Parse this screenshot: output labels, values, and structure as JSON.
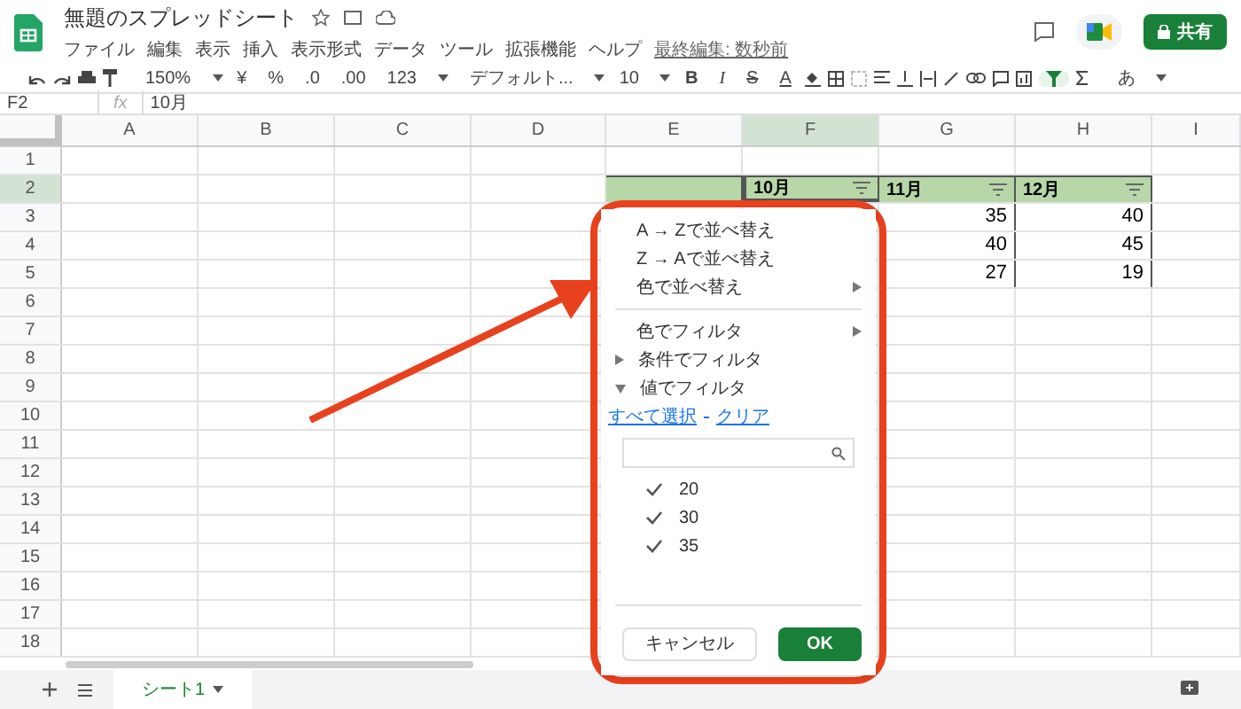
{
  "document": {
    "title": "無題のスプレッドシート",
    "last_edit": "最終編集: 数秒前",
    "share": "共有"
  },
  "menu": [
    "ファイル",
    "編集",
    "表示",
    "挿入",
    "表示形式",
    "データ",
    "ツール",
    "拡張機能",
    "ヘルプ"
  ],
  "toolbar": {
    "zoom": "150%",
    "currency": "¥",
    "percent": "%",
    "decrease_decimal": ".0",
    "increase_decimal": ".00",
    "number_format": "123",
    "font": "デフォルト...",
    "font_size": "10",
    "bold": "B",
    "italic": "I",
    "strike": "S",
    "text_color": "A",
    "input_tool": "あ",
    "filter_on": true
  },
  "formula_bar": {
    "cell": "F2",
    "fx": "fx",
    "value": "10月"
  },
  "columns": [
    {
      "label": "A",
      "selected": false
    },
    {
      "label": "B",
      "selected": false
    },
    {
      "label": "C",
      "selected": false
    },
    {
      "label": "D",
      "selected": false
    },
    {
      "label": "E",
      "selected": false
    },
    {
      "label": "F",
      "selected": true
    },
    {
      "label": "G",
      "selected": false
    },
    {
      "label": "H",
      "selected": false
    },
    {
      "label": "I",
      "selected": false
    }
  ],
  "rows": [
    {
      "label": "1",
      "selected": false
    },
    {
      "label": "2",
      "selected": true
    },
    {
      "label": "3",
      "selected": false
    },
    {
      "label": "4",
      "selected": false
    },
    {
      "label": "5",
      "selected": false
    },
    {
      "label": "6",
      "selected": false
    },
    {
      "label": "7",
      "selected": false
    },
    {
      "label": "8",
      "selected": false
    },
    {
      "label": "9",
      "selected": false
    },
    {
      "label": "10",
      "selected": false
    },
    {
      "label": "11",
      "selected": false
    },
    {
      "label": "12",
      "selected": false
    },
    {
      "label": "13",
      "selected": false
    },
    {
      "label": "14",
      "selected": false
    },
    {
      "label": "15",
      "selected": false
    },
    {
      "label": "16",
      "selected": false
    },
    {
      "label": "17",
      "selected": false
    },
    {
      "label": "18",
      "selected": false
    }
  ],
  "table": {
    "header": [
      {
        "text": "10月",
        "filter": true
      },
      {
        "text": "11月",
        "filter": true
      },
      {
        "text": "12月",
        "filter": true
      }
    ],
    "rows": [
      [
        "35",
        "40"
      ],
      [
        "40",
        "45"
      ],
      [
        "27",
        "19"
      ]
    ]
  },
  "filter_menu": {
    "items": [
      {
        "kind": "action",
        "label": "A → Zで並べ替え"
      },
      {
        "kind": "action",
        "label": "Z → Aで並べ替え"
      },
      {
        "kind": "submenu",
        "label": "色で並べ替え"
      },
      {
        "kind": "divider"
      },
      {
        "kind": "submenu",
        "label": "色でフィルタ"
      },
      {
        "kind": "expander",
        "label": "条件でフィルタ",
        "expanded": false
      },
      {
        "kind": "expander",
        "label": "値でフィルタ",
        "expanded": true
      }
    ],
    "select_all": "すべて選択",
    "clear": "クリア",
    "values": [
      {
        "label": "20",
        "checked": true
      },
      {
        "label": "30",
        "checked": true
      },
      {
        "label": "35",
        "checked": true
      }
    ],
    "cancel": "キャンセル",
    "ok": "OK"
  },
  "sheet_tabs": [
    {
      "label": "シート1",
      "selected": true
    }
  ]
}
